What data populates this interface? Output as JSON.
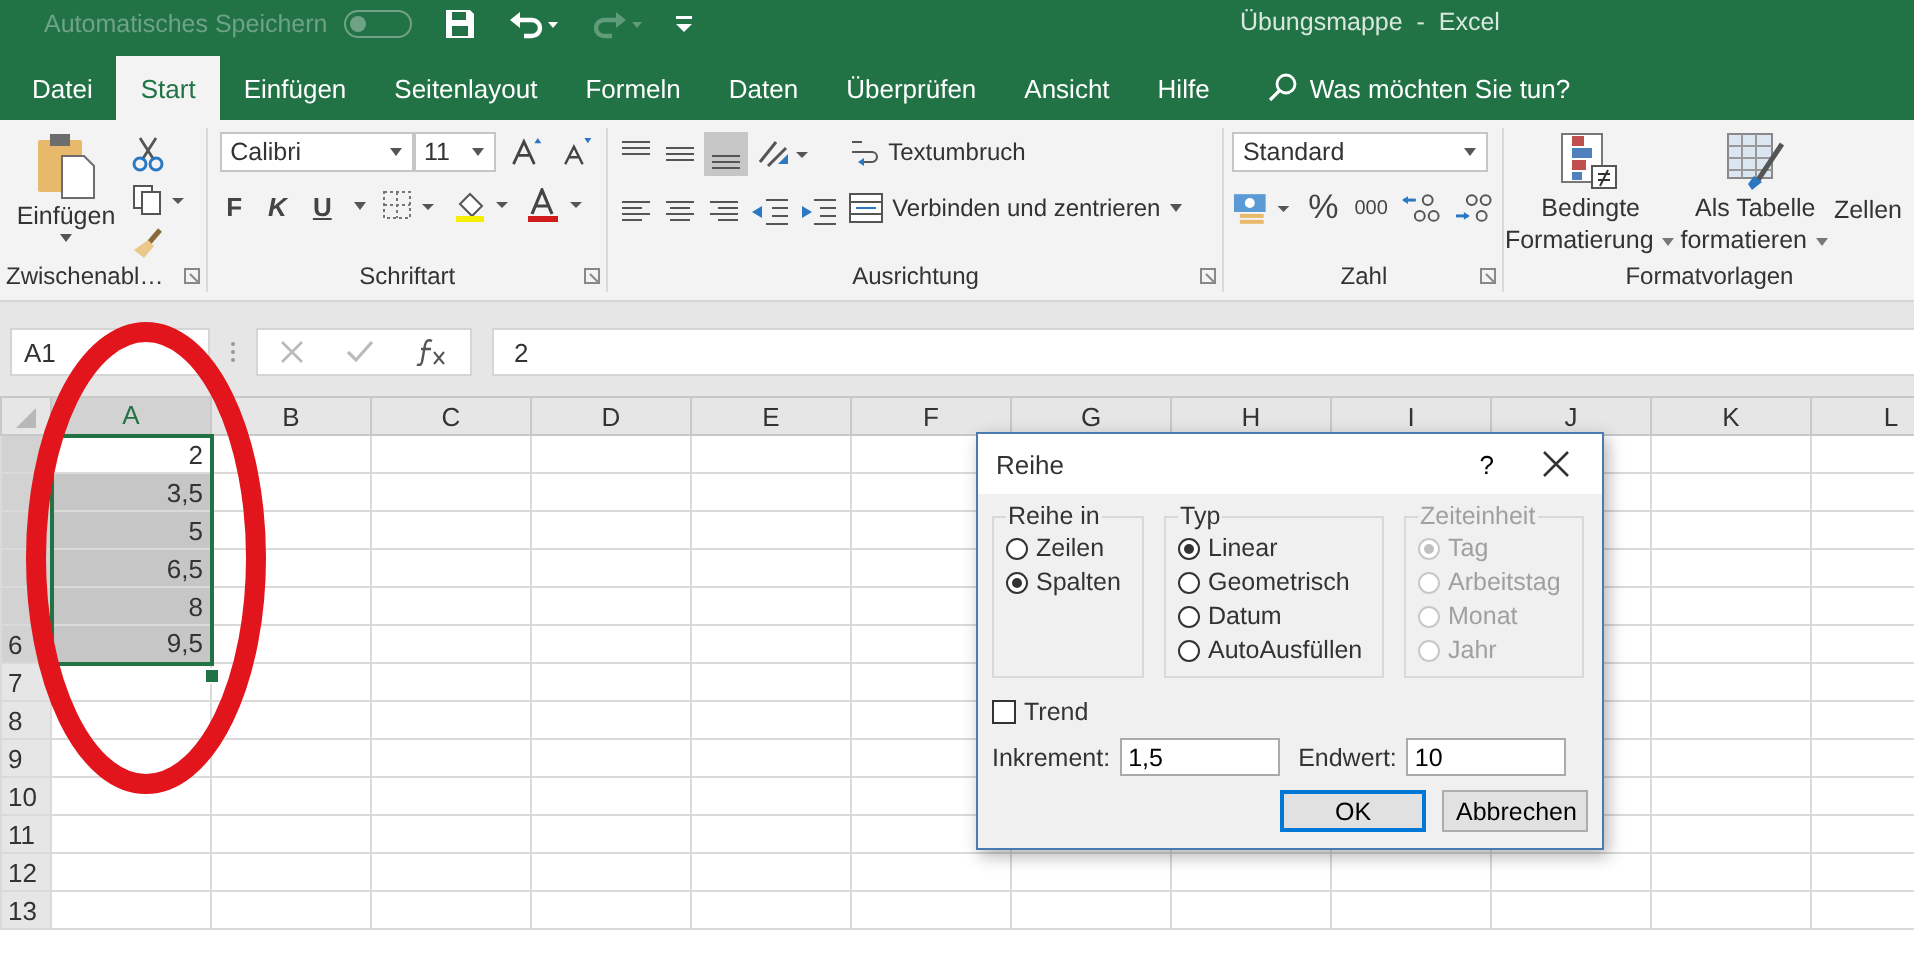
{
  "title_bar": {
    "autosave_label": "Automatisches Speichern",
    "autosave_on": false,
    "title": "Übungsmappe  -  Excel"
  },
  "tabs": [
    {
      "label": "Datei",
      "selected": false
    },
    {
      "label": "Start",
      "selected": true
    },
    {
      "label": "Einfügen",
      "selected": false
    },
    {
      "label": "Seitenlayout",
      "selected": false
    },
    {
      "label": "Formeln",
      "selected": false
    },
    {
      "label": "Daten",
      "selected": false
    },
    {
      "label": "Überprüfen",
      "selected": false
    },
    {
      "label": "Ansicht",
      "selected": false
    },
    {
      "label": "Hilfe",
      "selected": false
    }
  ],
  "tell_me": "Was möchten Sie tun?",
  "ribbon": {
    "clipboard": {
      "paste": "Einfügen",
      "label": "Zwischenabl…"
    },
    "font": {
      "name": "Calibri",
      "size": "11",
      "bold": "F",
      "italic": "K",
      "underline": "U",
      "label": "Schriftart"
    },
    "alignment": {
      "wrap": "Textumbruch",
      "merge": "Verbinden und zentrieren",
      "label": "Ausrichtung"
    },
    "number": {
      "format": "Standard",
      "percent": "%",
      "thousands": "000",
      "label": "Zahl"
    },
    "styles": {
      "conditional": [
        "Bedingte",
        "Formatierung"
      ],
      "table": [
        "Als Tabelle",
        "formatieren"
      ],
      "cells": "Zellen",
      "label": "Formatvorlagen"
    }
  },
  "formula_bar": {
    "name_box": "A1",
    "formula": "2"
  },
  "columns": [
    {
      "label": "A",
      "selected": true
    },
    {
      "label": "B",
      "selected": false
    },
    {
      "label": "C",
      "selected": false
    },
    {
      "label": "D",
      "selected": false
    },
    {
      "label": "E",
      "selected": false
    },
    {
      "label": "F",
      "selected": false
    },
    {
      "label": "G",
      "selected": false
    },
    {
      "label": "H",
      "selected": false
    },
    {
      "label": "I",
      "selected": false
    },
    {
      "label": "J",
      "selected": false
    },
    {
      "label": "K",
      "selected": false
    },
    {
      "label": "L",
      "selected": false
    }
  ],
  "rows": [
    {
      "value": "2",
      "selected": false
    },
    {
      "value": "3,5",
      "selected": true
    },
    {
      "value": "5",
      "selected": true
    },
    {
      "value": "6,5",
      "selected": true
    },
    {
      "value": "8",
      "selected": true
    },
    {
      "header": "6",
      "value": "9,5",
      "selected": true
    },
    {
      "header": "7"
    },
    {
      "header": "8"
    },
    {
      "header": "9"
    },
    {
      "header": "10"
    },
    {
      "header": "11"
    },
    {
      "header": "12"
    },
    {
      "header": "13"
    }
  ],
  "dialog": {
    "title": "Reihe",
    "help": "?",
    "groups": [
      {
        "title": "Reihe in",
        "disabled": false,
        "options": [
          {
            "label": "Zeilen",
            "selected": false
          },
          {
            "label": "Spalten",
            "selected": true
          }
        ]
      },
      {
        "title": "Typ",
        "disabled": false,
        "options": [
          {
            "label": "Linear",
            "selected": true
          },
          {
            "label": "Geometrisch",
            "selected": false
          },
          {
            "label": "Datum",
            "selected": false
          },
          {
            "label": "AutoAusfüllen",
            "selected": false
          }
        ]
      },
      {
        "title": "Zeiteinheit",
        "disabled": true,
        "options": [
          {
            "label": "Tag",
            "selected": true
          },
          {
            "label": "Arbeitstag",
            "selected": false
          },
          {
            "label": "Monat",
            "selected": false
          },
          {
            "label": "Jahr",
            "selected": false
          }
        ]
      }
    ],
    "trend": {
      "label": "Trend",
      "checked": false
    },
    "increment": {
      "label": "Inkrement:",
      "value": "1,5"
    },
    "end": {
      "label": "Endwert:",
      "value": "10"
    },
    "buttons": [
      "OK",
      "Abbrechen"
    ]
  }
}
